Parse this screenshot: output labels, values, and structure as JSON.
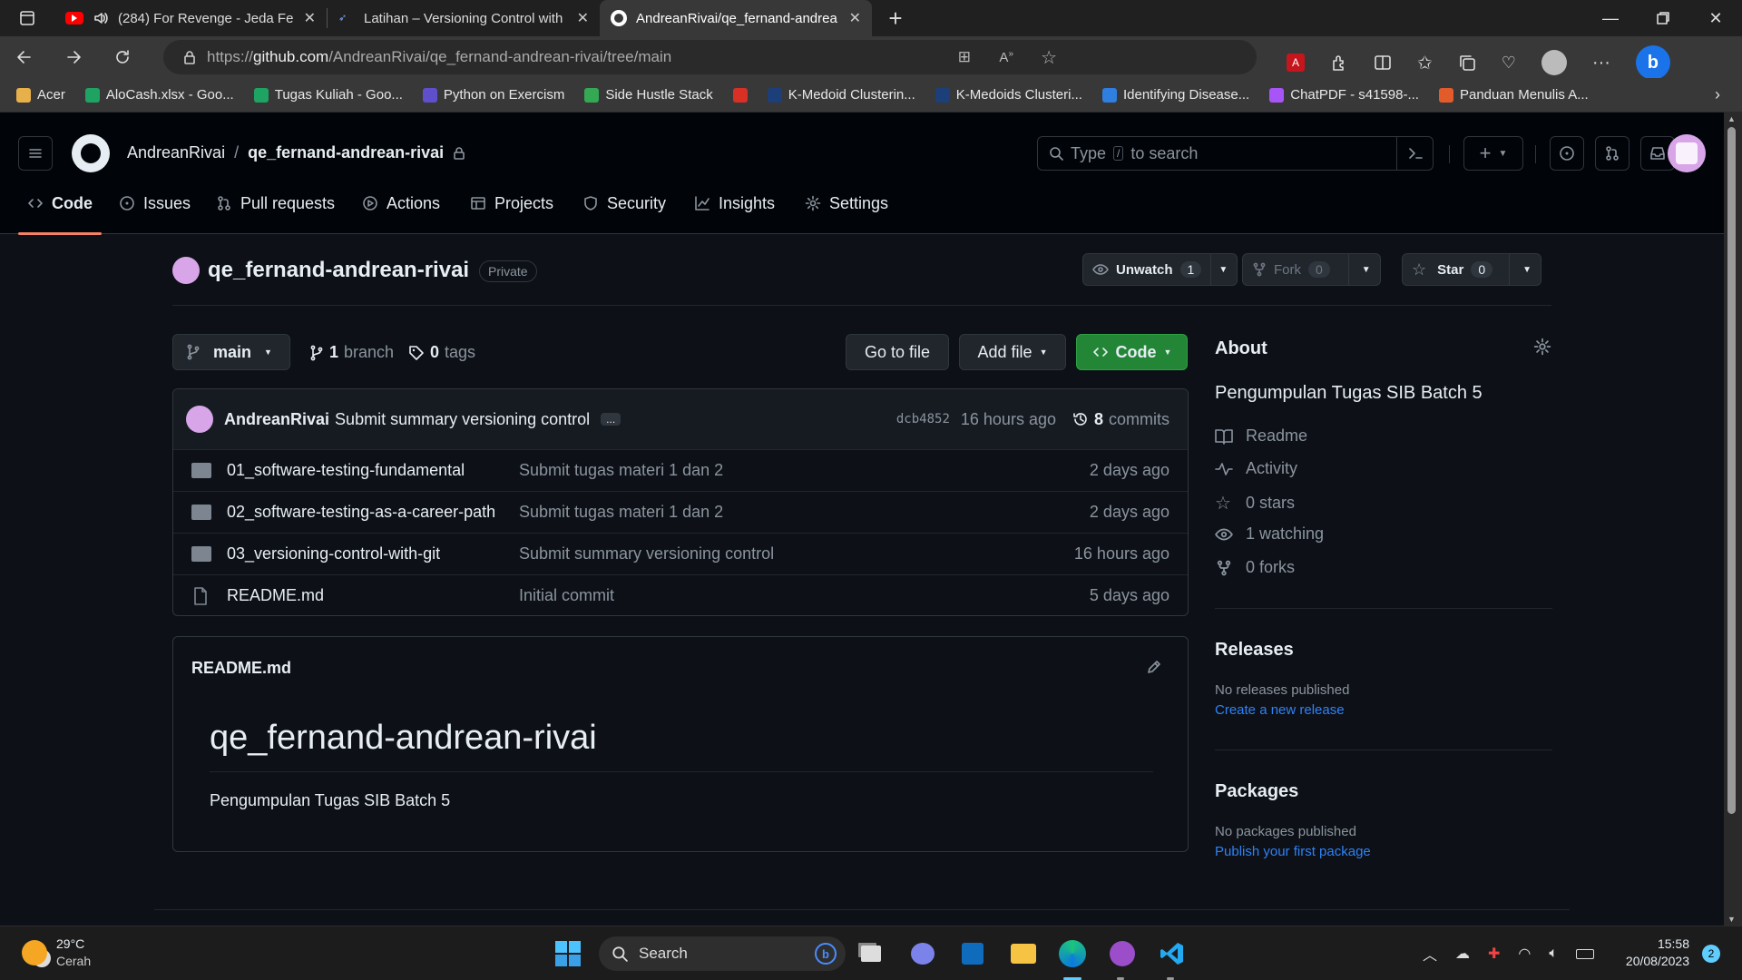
{
  "browser": {
    "tabs": [
      {
        "title": "(284) For Revenge - Jeda Fe",
        "active": false
      },
      {
        "title": "Latihan – Versioning Control with",
        "active": false
      },
      {
        "title": "AndreanRivai/qe_fernand-andrea",
        "active": true
      }
    ],
    "url_prefix": "https://",
    "url_host": "github.com",
    "url_path": "/AndreanRivai/qe_fernand-andrean-rivai/tree/main",
    "bookmarks": [
      {
        "label": "Acer",
        "color": "#e8b04a"
      },
      {
        "label": "AloCash.xlsx - Goo...",
        "color": "#1ea362"
      },
      {
        "label": "Tugas Kuliah - Goo...",
        "color": "#1ea362"
      },
      {
        "label": "Python on Exercism",
        "color": "#604fcd"
      },
      {
        "label": "Side Hustle Stack",
        "color": "#34a853"
      },
      {
        "label": "",
        "color": "#d93025"
      },
      {
        "label": "K-Medoid Clusterin...",
        "color": "#1c3f7a"
      },
      {
        "label": "K-Medoids Clusteri...",
        "color": "#1c3f7a"
      },
      {
        "label": "Identifying Disease...",
        "color": "#2e7fe0"
      },
      {
        "label": "ChatPDF - s41598-...",
        "color": "#a855f7"
      },
      {
        "label": "Panduan Menulis A...",
        "color": "#e25c2b"
      }
    ]
  },
  "header": {
    "owner": "AndreanRivai",
    "separator": "/",
    "repo": "qe_fernand-andrean-rivai",
    "search_placeholder_pre": "Type",
    "search_key": "/",
    "search_placeholder_post": "to search",
    "nav": [
      "Code",
      "Issues",
      "Pull requests",
      "Actions",
      "Projects",
      "Security",
      "Insights",
      "Settings"
    ]
  },
  "repo_head": {
    "name": "qe_fernand-andrean-rivai",
    "visibility": "Private",
    "unwatch_label": "Unwatch",
    "unwatch_count": "1",
    "fork_label": "Fork",
    "fork_count": "0",
    "star_label": "Star",
    "star_count": "0"
  },
  "toolbar": {
    "branch": "main",
    "branch_count": "1",
    "branch_label": "branch",
    "tag_count": "0",
    "tag_label": "tags",
    "go_to_file": "Go to file",
    "add_file": "Add file",
    "code": "Code"
  },
  "commit": {
    "author": "AndreanRivai",
    "message": "Submit summary versioning control",
    "ellipsis": "...",
    "sha": "dcb4852",
    "time": "16 hours ago",
    "count": "8",
    "count_label": "commits"
  },
  "files": [
    {
      "name": "01_software-testing-fundamental",
      "type": "folder",
      "message": "Submit tugas materi 1 dan 2",
      "age": "2 days ago"
    },
    {
      "name": "02_software-testing-as-a-career-path",
      "type": "folder",
      "message": "Submit tugas materi 1 dan 2",
      "age": "2 days ago"
    },
    {
      "name": "03_versioning-control-with-git",
      "type": "folder",
      "message": "Submit summary versioning control",
      "age": "16 hours ago"
    },
    {
      "name": "README.md",
      "type": "file",
      "message": "Initial commit",
      "age": "5 days ago"
    }
  ],
  "readme": {
    "filename": "README.md",
    "heading": "qe_fernand-andrean-rivai",
    "body": "Pengumpulan Tugas SIB Batch 5"
  },
  "about": {
    "title": "About",
    "description": "Pengumpulan Tugas SIB Batch 5",
    "items": [
      "Readme",
      "Activity",
      "0 stars",
      "1 watching",
      "0 forks"
    ],
    "releases_title": "Releases",
    "releases_none": "No releases published",
    "releases_link": "Create a new release",
    "packages_title": "Packages",
    "packages_none": "No packages published",
    "packages_link": "Publish your first package"
  },
  "taskbar": {
    "temp": "29°C",
    "weather": "Cerah",
    "search": "Search",
    "time": "15:58",
    "date": "20/08/2023",
    "badge": "2"
  },
  "colors": {
    "accent_green": "#238636",
    "link_blue": "#2f81f7",
    "tab_underline": "#f78166"
  }
}
